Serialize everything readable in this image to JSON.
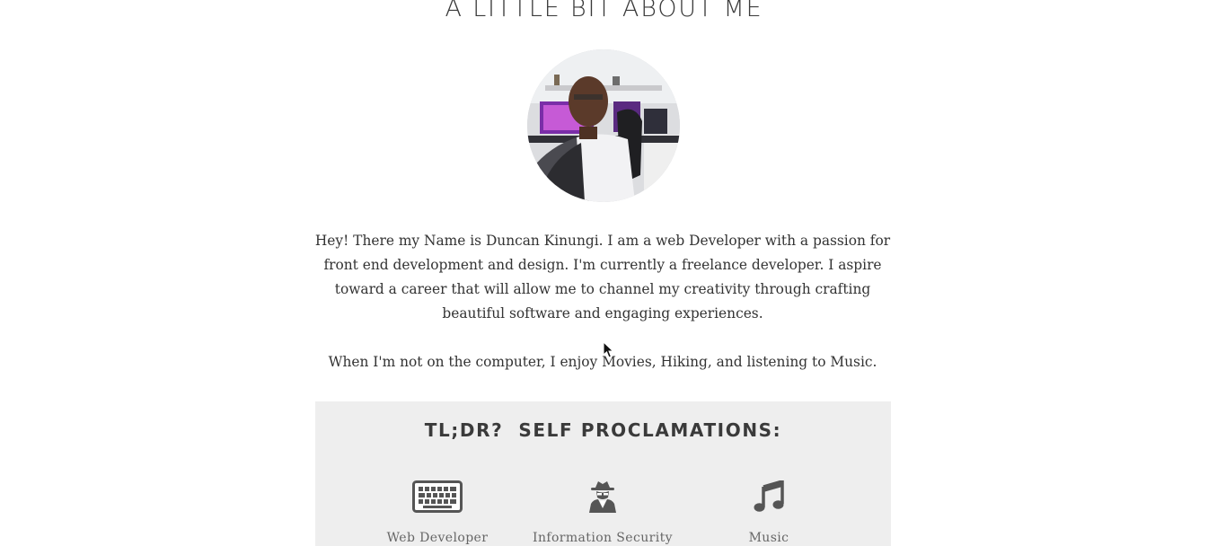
{
  "about": {
    "title": "A LITTLE BIT ABOUT ME",
    "bio": "Hey! There my Name is Duncan Kinungi. I am a web Developer with a passion for front end development and design. I'm currently a freelance developer. I aspire toward a career that will allow me to channel my creativity through crafting beautiful software and engaging experiences.",
    "hobbies": "When I'm not on the computer, I enjoy Movies, Hiking, and listening to Music."
  },
  "tldr": {
    "title": "TL;DR?  SELF PROCLAMATIONS:",
    "items": [
      {
        "label": "Web Developer",
        "icon": "keyboard-icon"
      },
      {
        "label": "Information Security",
        "icon": "user-secret-icon"
      },
      {
        "label": "Music",
        "icon": "music-note-icon"
      }
    ]
  },
  "colors": {
    "panel_bg": "#eeeeee",
    "icon": "#555555",
    "text": "#333333"
  }
}
